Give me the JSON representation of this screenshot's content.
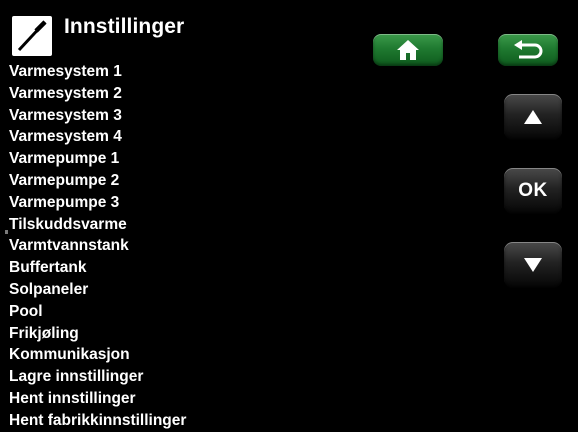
{
  "header": {
    "title": "Innstillinger",
    "icon": "screwdriver-icon"
  },
  "menu": {
    "items": [
      {
        "label": "Varmesystem 1"
      },
      {
        "label": "Varmesystem 2"
      },
      {
        "label": "Varmesystem 3"
      },
      {
        "label": "Varmesystem 4"
      },
      {
        "label": "Varmepumpe 1"
      },
      {
        "label": "Varmepumpe 2"
      },
      {
        "label": "Varmepumpe 3"
      },
      {
        "label": "Tilskuddsvarme"
      },
      {
        "label": "Varmtvannstank"
      },
      {
        "label": "Buffertank"
      },
      {
        "label": "Solpaneler"
      },
      {
        "label": "Pool"
      },
      {
        "label": "Frikjøling"
      },
      {
        "label": "Kommunikasjon"
      },
      {
        "label": "Lagre innstillinger"
      },
      {
        "label": "Hent innstillinger"
      },
      {
        "label": "Hent fabrikkinnstillinger"
      }
    ]
  },
  "buttons": {
    "home_icon": "home-icon",
    "back_icon": "return-arrow-icon",
    "up_icon": "up-triangle-icon",
    "ok_label": "OK",
    "down_icon": "down-triangle-icon"
  },
  "colors": {
    "background": "#000000",
    "text": "#ffffff",
    "nav_button_green": "#1f7a30",
    "control_button_dark": "#222222"
  }
}
